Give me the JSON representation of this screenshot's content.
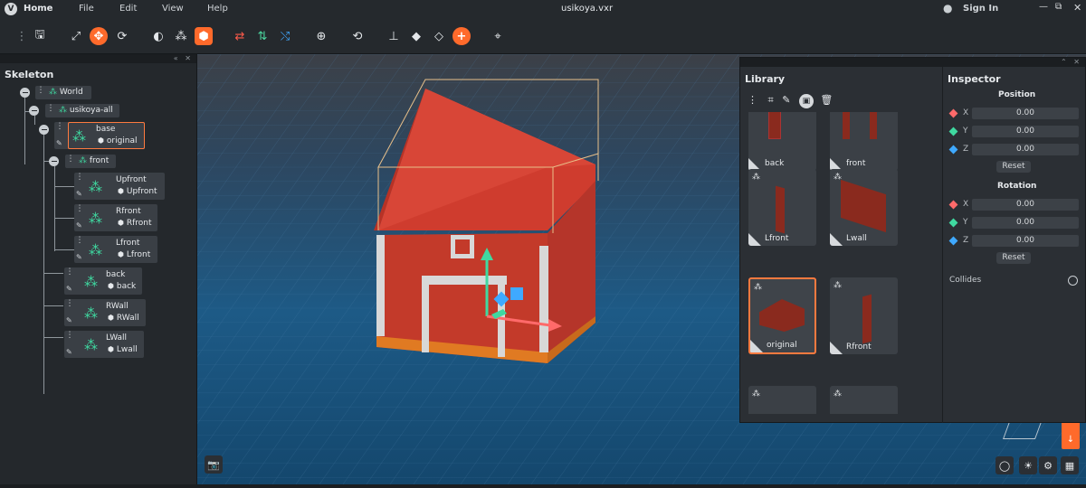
{
  "menubar": {
    "home": "Home",
    "file": "File",
    "edit": "Edit",
    "view": "View",
    "help": "Help",
    "title": "usikoya.vxr",
    "signin": "Sign In"
  },
  "skeleton": {
    "title": "Skeleton",
    "nodes": {
      "world": "World",
      "usikoya": "usikoya-all",
      "base": "base",
      "base_model": "original",
      "front": "front",
      "upfront": "Upfront",
      "upfront_model": "Upfront",
      "rfront": "Rfront",
      "rfront_model": "Rfront",
      "lfront": "Lfront",
      "lfront_model": "Lfront",
      "back": "back",
      "back_model": "back",
      "rwall": "RWall",
      "rwall_model": "RWall",
      "lwall": "LWall",
      "lwall_model": "Lwall"
    }
  },
  "library": {
    "title": "Library",
    "cards": [
      "back",
      "front",
      "Lfront",
      "Lwall",
      "original",
      "Rfront"
    ]
  },
  "inspector": {
    "title": "Inspector",
    "position_label": "Position",
    "rotation_label": "Rotation",
    "x": "X",
    "y": "Y",
    "z": "Z",
    "px": "0.00",
    "py": "0.00",
    "pz": "0.00",
    "rx": "0.00",
    "ry": "0.00",
    "rz": "0.00",
    "reset": "Reset",
    "collides": "Collides"
  },
  "colors": {
    "accent": "#ff6a2b",
    "node_green": "#3fd9a0",
    "axis_x": "#ff5a5a",
    "axis_y": "#3fd9a0",
    "axis_z": "#3fa9ff"
  }
}
